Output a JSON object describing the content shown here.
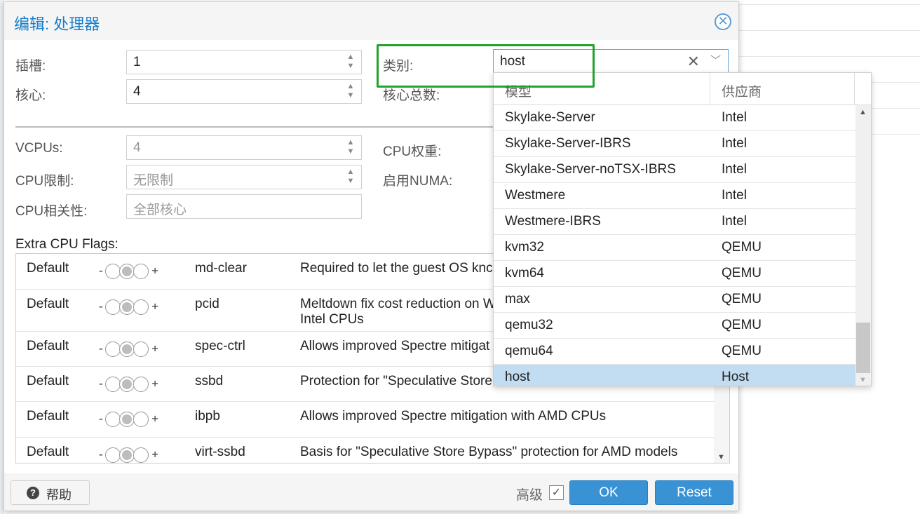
{
  "dialog": {
    "title": "编辑: 处理器"
  },
  "form": {
    "sockets": {
      "label": "插槽:",
      "value": "1"
    },
    "cores": {
      "label": "核心:",
      "value": "4"
    },
    "type": {
      "label": "类别:",
      "value": "host"
    },
    "total_cores": {
      "label": "核心总数:"
    },
    "vcpus": {
      "label": "VCPUs:",
      "value": "4"
    },
    "cpu_weight": {
      "label": "CPU权重:"
    },
    "cpu_limit": {
      "label": "CPU限制:",
      "value": "无限制"
    },
    "numa": {
      "label": "启用NUMA:"
    },
    "affinity": {
      "label": "CPU相关性:",
      "value": "全部核心"
    }
  },
  "flags": {
    "label": "Extra CPU Flags:",
    "rows": [
      {
        "state": "Default",
        "minus": "-",
        "plus": "+",
        "flag": "md-clear",
        "desc": "Required to let the guest OS knc"
      },
      {
        "state": "Default",
        "minus": "-",
        "plus": "+",
        "flag": "pcid",
        "desc": "Meltdown fix cost reduction on W",
        "desc2": "Intel CPUs"
      },
      {
        "state": "Default",
        "minus": "-",
        "plus": "+",
        "flag": "spec-ctrl",
        "desc": "Allows improved Spectre mitigat"
      },
      {
        "state": "Default",
        "minus": "-",
        "plus": "+",
        "flag": "ssbd",
        "desc": "Protection for \"Speculative Store"
      },
      {
        "state": "Default",
        "minus": "-",
        "plus": "+",
        "flag": "ibpb",
        "desc": "Allows improved Spectre mitigation with AMD CPUs"
      },
      {
        "state": "Default",
        "minus": "-",
        "plus": "+",
        "flag": "virt-ssbd",
        "desc": "Basis for \"Speculative Store Bypass\" protection for AMD models"
      }
    ]
  },
  "picker": {
    "col_model": "模型",
    "col_vendor": "供应商",
    "rows": [
      {
        "model": "Skylake-Server",
        "vendor": "Intel"
      },
      {
        "model": "Skylake-Server-IBRS",
        "vendor": "Intel"
      },
      {
        "model": "Skylake-Server-noTSX-IBRS",
        "vendor": "Intel"
      },
      {
        "model": "Westmere",
        "vendor": "Intel"
      },
      {
        "model": "Westmere-IBRS",
        "vendor": "Intel"
      },
      {
        "model": "kvm32",
        "vendor": "QEMU"
      },
      {
        "model": "kvm64",
        "vendor": "QEMU"
      },
      {
        "model": "max",
        "vendor": "QEMU"
      },
      {
        "model": "qemu32",
        "vendor": "QEMU"
      },
      {
        "model": "qemu64",
        "vendor": "QEMU"
      },
      {
        "model": "host",
        "vendor": "Host"
      }
    ]
  },
  "footer": {
    "help": "帮助",
    "advanced": "高级",
    "ok": "OK",
    "reset": "Reset"
  },
  "icons": {
    "close": "close-icon",
    "help": "help-icon",
    "clear": "clear-icon",
    "dropdown": "chevron-down-icon"
  },
  "colors": {
    "accent": "#157fcc",
    "primary_button": "#3892d4",
    "selected_row": "#c2ddf2",
    "highlight": "#22a32a"
  }
}
